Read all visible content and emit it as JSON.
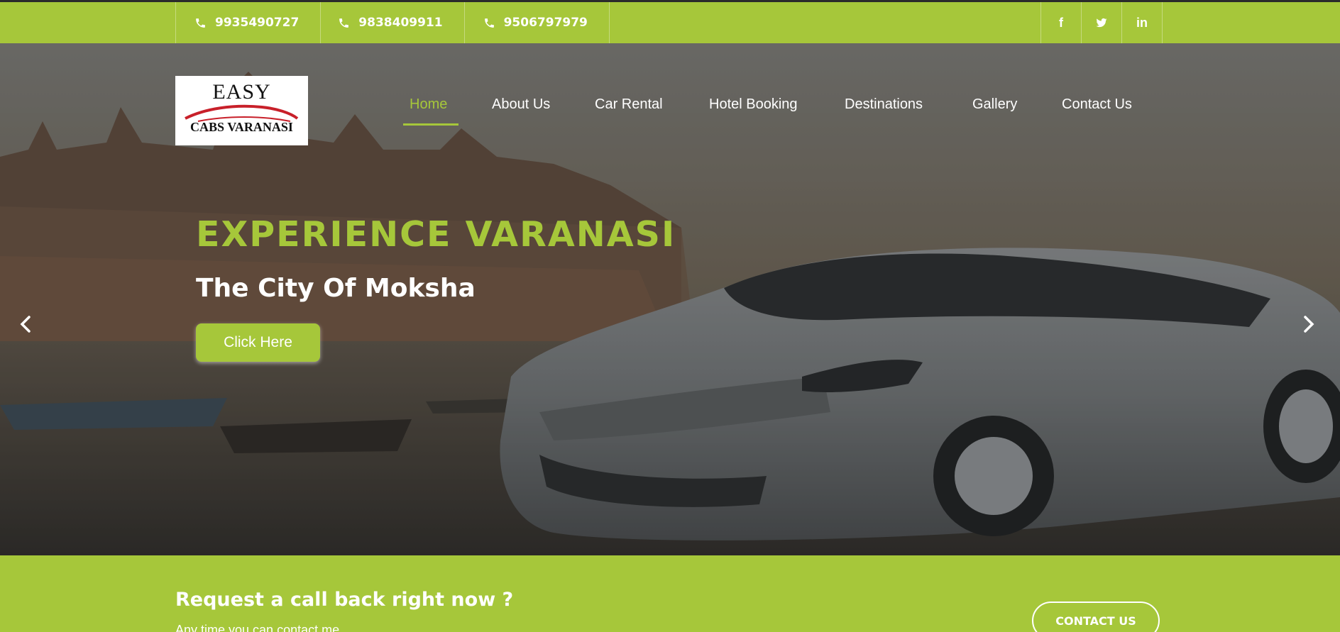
{
  "topbar": {
    "phones": [
      "9935490727",
      "9838409911",
      "9506797979"
    ],
    "social": [
      {
        "icon": "facebook-icon",
        "glyph": "f"
      },
      {
        "icon": "twitter-icon"
      },
      {
        "icon": "linkedin-icon",
        "glyph": "in"
      }
    ]
  },
  "logo": {
    "line1": "EASY",
    "line2": "CABS VARANASI"
  },
  "nav": {
    "items": [
      "Home",
      "About Us",
      "Car Rental",
      "Hotel Booking",
      "Destinations",
      "Gallery",
      "Contact Us"
    ],
    "active": "Home"
  },
  "hero": {
    "title": "EXPERIENCE VARANASI",
    "subtitle": "The City Of Moksha",
    "button": "Click Here"
  },
  "cta": {
    "title": "Request a call back right now ?",
    "subtitle": "Any time you can contact me",
    "button": "CONTACT US"
  },
  "colors": {
    "accent": "#a6c73a",
    "text_light": "#ffffff"
  }
}
